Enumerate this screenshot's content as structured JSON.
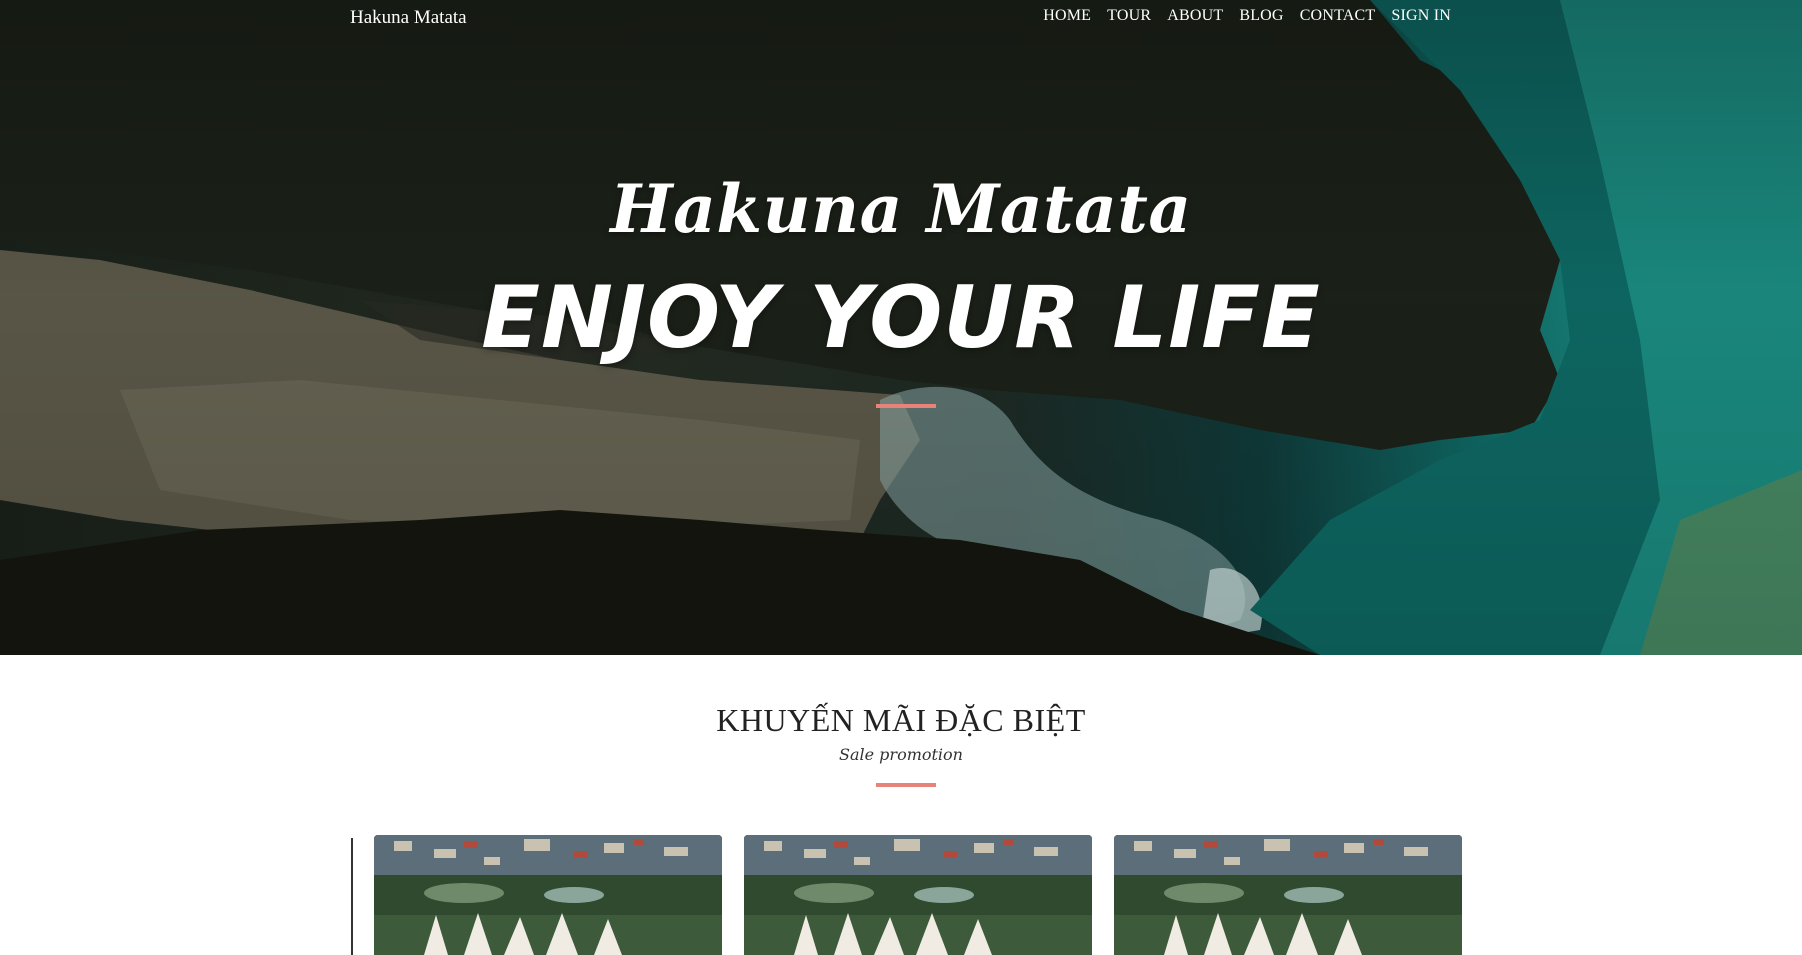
{
  "navbar": {
    "brand": "Hakuna Matata",
    "menu": [
      "HOME",
      "TOUR",
      "ABOUT",
      "BLOG",
      "CONTACT",
      "SIGN IN"
    ]
  },
  "hero": {
    "title": "Hakuna Matata",
    "subtitle": "ENJOY YOUR LIFE"
  },
  "promo": {
    "heading": "KHUYẾN MÃI ĐẶC BIỆT",
    "subheading": "Sale promotion",
    "cards": [
      {
        "image": "resort-aerial-photo"
      },
      {
        "image": "resort-aerial-photo"
      },
      {
        "image": "resort-aerial-photo"
      }
    ]
  },
  "colors": {
    "accent": "#e8837a",
    "text_dark": "#222222",
    "nav_text": "#ffffff",
    "sea": "#1c8f84"
  }
}
